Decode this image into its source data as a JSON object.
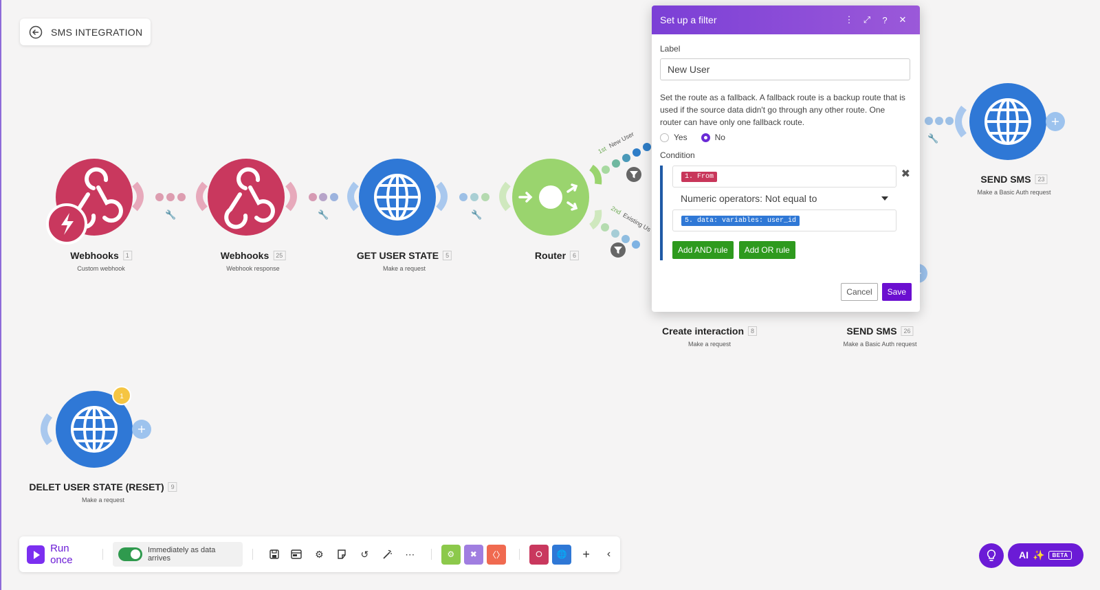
{
  "back": {
    "label": "SMS INTEGRATION"
  },
  "modules": [
    {
      "name": "Webhooks",
      "num": "1",
      "sub": "Custom webhook"
    },
    {
      "name": "Webhooks",
      "num": "25",
      "sub": "Webhook response"
    },
    {
      "name": "GET USER STATE",
      "num": "5",
      "sub": "Make a request"
    },
    {
      "name": "Router",
      "num": "6",
      "sub": ""
    },
    {
      "name": "Create interaction",
      "num": "8",
      "sub": "Make a request"
    },
    {
      "name": "SEND SMS",
      "num": "26",
      "sub": "Make a Basic Auth request"
    },
    {
      "name": "SEND SMS",
      "num": "23",
      "sub": "Make a Basic Auth request"
    },
    {
      "name": "DELET USER STATE (RESET)",
      "num": "9",
      "sub": "Make a request"
    }
  ],
  "routes": {
    "first": "1st",
    "first_label": "New User",
    "second": "2nd",
    "second_label": "Existing Us"
  },
  "badge": {
    "count": "1"
  },
  "filter": {
    "title": "Set up a filter",
    "label_caption": "Label",
    "label_value": "New User",
    "description": "Set the route as a fallback. A fallback route is a backup route that is used if the source data didn't go through any other route. One router can have only one fallback route.",
    "yes": "Yes",
    "no": "No",
    "condition_caption": "Condition",
    "field_left": "1. From",
    "operator": "Numeric operators: Not equal to",
    "field_right": "5. data: variables: user_id",
    "add_and": "Add AND rule",
    "add_or": "Add OR rule",
    "cancel": "Cancel",
    "save": "Save"
  },
  "toolbar": {
    "run_once": "Run once",
    "schedule": "Immediately as data arrives"
  },
  "ai": {
    "label": "AI",
    "beta": "BETA"
  },
  "colors": {
    "webhook": "#c9385e",
    "http": "#2f78d6",
    "router": "#9ad46e",
    "accent": "#6b1bd6"
  }
}
